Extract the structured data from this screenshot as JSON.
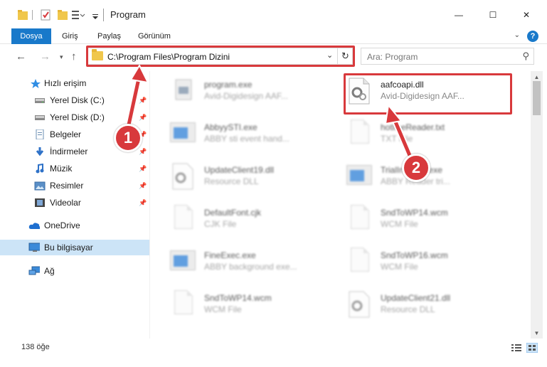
{
  "window": {
    "title": "Program",
    "controls": {
      "minimize": "—",
      "maximize": "☐",
      "close": "✕"
    }
  },
  "ribbon": {
    "tabs": [
      "Dosya",
      "Giriş",
      "Paylaş",
      "Görünüm"
    ],
    "help": "?"
  },
  "address": {
    "path": "C:\\Program Files\\Program Dizini"
  },
  "search": {
    "placeholder": "Ara: Program"
  },
  "sidebar": {
    "items": [
      {
        "label": "Hızlı erişim",
        "icon": "star-icon",
        "pinned": false
      },
      {
        "label": "Yerel Disk (C:)",
        "icon": "drive-icon",
        "pinned": true
      },
      {
        "label": "Yerel Disk (D:)",
        "icon": "drive-icon",
        "pinned": true
      },
      {
        "label": "Belgeler",
        "icon": "documents-icon",
        "pinned": true
      },
      {
        "label": "İndirmeler",
        "icon": "download-icon",
        "pinned": true
      },
      {
        "label": "Müzik",
        "icon": "music-icon",
        "pinned": true
      },
      {
        "label": "Resimler",
        "icon": "pictures-icon",
        "pinned": true
      },
      {
        "label": "Videolar",
        "icon": "videos-icon",
        "pinned": true
      },
      {
        "label": "OneDrive",
        "icon": "cloud-icon",
        "pinned": false
      },
      {
        "label": "Bu bilgisayar",
        "icon": "computer-icon",
        "pinned": false
      },
      {
        "label": "Ağ",
        "icon": "network-icon",
        "pinned": false
      }
    ]
  },
  "files": [
    {
      "name": "program.exe",
      "type": "Avid-Digidesign AAF...",
      "icon": "app-icon",
      "blurred": true
    },
    {
      "name": "aafcoapi.dll",
      "type": "Avid-Digidesign AAF...",
      "icon": "dll-gear-icon",
      "blurred": false
    },
    {
      "name": "AbbyySTI.exe",
      "type": "ABBY sti event hand...",
      "icon": "window-app-icon",
      "blurred": true
    },
    {
      "name": "hotlineReader.txt",
      "type": "TXT File",
      "icon": "text-file-icon",
      "blurred": true
    },
    {
      "name": "UpdateClient19.dll",
      "type": "Resource DLL",
      "icon": "dll-gear-icon",
      "blurred": true
    },
    {
      "name": "TrialInstaller.exe",
      "type": "ABBY Reader tri...",
      "icon": "window-app-icon",
      "blurred": true
    },
    {
      "name": "DefaultFont.cjk",
      "type": "CJK File",
      "icon": "file-icon",
      "blurred": true
    },
    {
      "name": "SndToWP14.wcm",
      "type": "WCM File",
      "icon": "file-icon",
      "blurred": true
    },
    {
      "name": "FineExec.exe",
      "type": "ABBY background exe...",
      "icon": "window-app-icon",
      "blurred": true
    },
    {
      "name": "SndToWP16.wcm",
      "type": "WCM File",
      "icon": "file-icon",
      "blurred": true
    },
    {
      "name": "SndToWP14.wcm",
      "type": "WCM File",
      "icon": "file-icon",
      "blurred": true
    },
    {
      "name": "UpdateClient21.dll",
      "type": "Resource DLL",
      "icon": "dll-gear-icon",
      "blurred": true
    }
  ],
  "status": {
    "item_count": "138 öğe"
  },
  "callouts": [
    "1",
    "2"
  ],
  "colors": {
    "accent": "#1979ca",
    "highlight": "#d8393c",
    "selected": "#cce4f7"
  }
}
